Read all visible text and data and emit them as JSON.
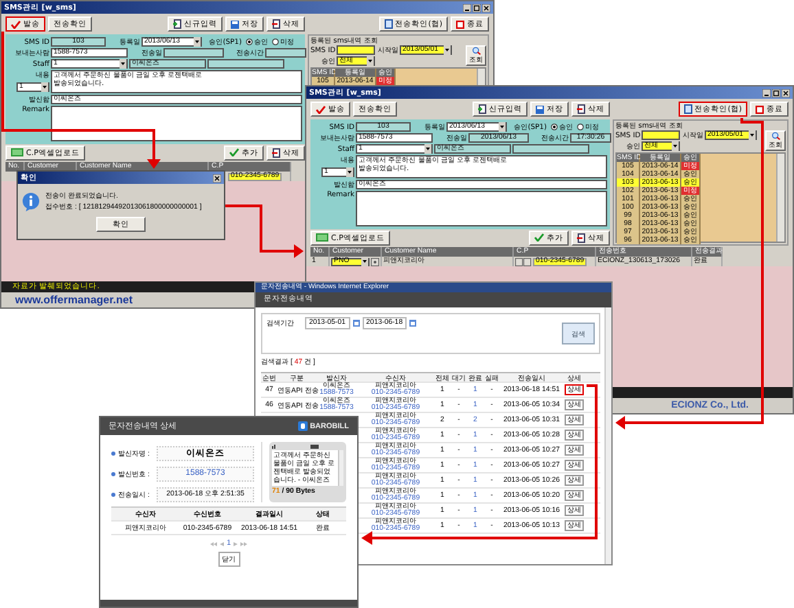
{
  "sms_windows": [
    {
      "title": "SMS관리 [w_sms]",
      "actions_left": [
        {
          "label": "발송",
          "kind": "check",
          "highlighted": true
        },
        {
          "label": "전송확인",
          "kind": "plain",
          "highlighted": false
        }
      ],
      "actions_mid": [
        {
          "label": "신규입력",
          "kind": "new",
          "highlighted": false
        },
        {
          "label": "저장",
          "kind": "save",
          "highlighted": false
        },
        {
          "label": "삭제",
          "kind": "delete",
          "highlighted": false
        }
      ],
      "actions_right": [
        {
          "label": "전송확인(협)",
          "kind": "doc",
          "highlighted": false
        },
        {
          "label": "종료",
          "kind": "exit",
          "highlighted": false
        }
      ],
      "form": {
        "sms_id_label": "SMS ID",
        "sms_id": "103",
        "reg_label": "등록일",
        "reg_date": "2013/06/13",
        "approval_label": "승인(SP1)",
        "approval": [
          {
            "label": "승인",
            "selected": true
          },
          {
            "label": "미정",
            "selected": false
          }
        ],
        "sender_label": "보내는사람",
        "sender": "1588-7573",
        "sent_date_label": "전송일",
        "sent_time_label": "전송시간",
        "staff_label": "Staff",
        "staff": "1",
        "staff_name": "이씨온즈",
        "content_label": "내용",
        "content": "고객께서 주문하신 물품이 금일 오후 로젠택배로\n발송되었습니다.",
        "count": "1",
        "from_label": "발신함",
        "from": "이씨온즈",
        "remark_label": "Remark"
      },
      "lookup": {
        "title": "등록된 sms내역 조회",
        "sms_id_label": "SMS ID",
        "start_label": "시작일",
        "start_date": "2013/05/01",
        "approval_label": "승인",
        "approval": "전체",
        "search": "조회",
        "columns": [
          "SMS ID",
          "등록일",
          "승인"
        ],
        "rows": [
          {
            "id": "105",
            "date": "2013-06-14",
            "status": "미정",
            "pending": true,
            "selected": false
          }
        ]
      },
      "cp": {
        "upload": "C.P엑셀업로드",
        "add": "추가",
        "delete": "삭제",
        "columns": [
          "No.",
          "Customer",
          "Customer Name",
          "C.P"
        ],
        "rows": [
          {
            "cp": "010-2345-6789"
          }
        ]
      },
      "status": "자료가 발췌되었습니다.",
      "url": "www.offermanager.net"
    },
    {
      "title": "SMS관리 [w_sms]",
      "actions_left": [
        {
          "label": "발송",
          "kind": "check",
          "highlighted": false
        },
        {
          "label": "전송확인",
          "kind": "plain",
          "highlighted": false
        }
      ],
      "actions_mid": [
        {
          "label": "신규입력",
          "kind": "new",
          "highlighted": false
        },
        {
          "label": "저장",
          "kind": "save",
          "highlighted": false
        },
        {
          "label": "삭제",
          "kind": "delete",
          "highlighted": false
        }
      ],
      "actions_right": [
        {
          "label": "전송확인(협)",
          "kind": "doc",
          "highlighted": true
        },
        {
          "label": "종료",
          "kind": "exit",
          "highlighted": false
        }
      ],
      "form": {
        "sms_id_label": "SMS ID",
        "sms_id": "103",
        "reg_label": "등록일",
        "reg_date": "2013/06/13",
        "approval_label": "승인(SP1)",
        "approval": [
          {
            "label": "승인",
            "selected": true
          },
          {
            "label": "미정",
            "selected": false
          }
        ],
        "sender_label": "보내는사람",
        "sender": "1588-7573",
        "sent_date_label": "전송일",
        "sent_date": "2013/06/13",
        "sent_time_label": "전송시간",
        "sent_time": "17:30:26",
        "staff_label": "Staff",
        "staff": "1",
        "staff_name": "이씨온즈",
        "content_label": "내용",
        "content": "고객께서 주문하신 물품이 금일 오후 로젠택배로\n발송되었습니다.",
        "count": "1",
        "from_label": "발신함",
        "from": "이씨온즈",
        "remark_label": "Remark"
      },
      "lookup": {
        "title": "등록된 sms내역 조회",
        "sms_id_label": "SMS ID",
        "start_label": "시작일",
        "start_date": "2013/05/01",
        "approval_label": "승인",
        "approval": "전체",
        "search": "조회",
        "columns": [
          "SMS ID",
          "등록일",
          "승인"
        ],
        "rows": [
          {
            "id": "105",
            "date": "2013-06-14",
            "status": "미정",
            "pending": true,
            "selected": false
          },
          {
            "id": "104",
            "date": "2013-06-14",
            "status": "승인",
            "pending": false,
            "selected": false
          },
          {
            "id": "103",
            "date": "2013-06-13",
            "status": "승인",
            "pending": false,
            "selected": true
          },
          {
            "id": "102",
            "date": "2013-06-13",
            "status": "미정",
            "pending": true,
            "selected": false
          },
          {
            "id": "101",
            "date": "2013-06-13",
            "status": "승인",
            "pending": false,
            "selected": false
          },
          {
            "id": "100",
            "date": "2013-06-13",
            "status": "승인",
            "pending": false,
            "selected": false
          },
          {
            "id": "99",
            "date": "2013-06-13",
            "status": "승인",
            "pending": false,
            "selected": false
          },
          {
            "id": "98",
            "date": "2013-06-13",
            "status": "승인",
            "pending": false,
            "selected": false
          },
          {
            "id": "97",
            "date": "2013-06-13",
            "status": "승인",
            "pending": false,
            "selected": false
          },
          {
            "id": "96",
            "date": "2013-06-13",
            "status": "승인",
            "pending": false,
            "selected": false
          }
        ]
      },
      "cp": {
        "upload": "C.P엑셀업로드",
        "add": "추가",
        "delete": "삭제",
        "columns": [
          "No.",
          "Customer",
          "Customer Name",
          "C.P",
          "전송번호",
          "전송결과"
        ],
        "rows": [
          {
            "no": "1",
            "customer": "PNO",
            "name": "피앤지코리아",
            "cp": "010-2345-6789",
            "send_no": "ECIONZ_130613_173026",
            "result": "완료"
          }
        ]
      },
      "company": "ECIONZ Co., Ltd."
    }
  ],
  "dialog": {
    "title": "확인",
    "lines": [
      "전송이 완료되었습니다.",
      "접수번호 : [ 12181294492013061800000000001 ]"
    ],
    "button": "확인"
  },
  "browser": {
    "title": "문자전송내역 - Windows Internet Explorer",
    "header": "문자전송내역",
    "period_label": "검색기간",
    "from": "2013-05-01",
    "to": "2013-06-18",
    "search": "검색",
    "result_label": "검색결과 [",
    "result_count": "47",
    "result_unit": "건 ]",
    "columns": [
      "순번",
      "구분",
      "발신자",
      "수신자",
      "전체",
      "대기",
      "완료",
      "실패",
      "전송일시",
      "상세"
    ],
    "rows": [
      {
        "no": "47",
        "type": "연동API 전송",
        "sender": "이씨온즈",
        "sender_no": "1588-7573",
        "receiver": "피앤지코리아",
        "receiver_no": "010-2345-6789",
        "total": "1",
        "waiting": "-",
        "done": "1",
        "failed": "-",
        "date": "2013-06-18 14:51",
        "detail": "상세",
        "highlighted": true
      },
      {
        "no": "46",
        "type": "연동API 전송",
        "sender": "이씨온즈",
        "sender_no": "1588-7573",
        "receiver": "피앤지코리아",
        "receiver_no": "010-2345-6789",
        "total": "1",
        "waiting": "-",
        "done": "1",
        "failed": "-",
        "date": "2013-06-05 10:34",
        "detail": "상세",
        "highlighted": false
      },
      {
        "receiver": "피앤지코리아",
        "receiver_no": "010-2345-6789",
        "total": "2",
        "waiting": "-",
        "done": "2",
        "failed": "-",
        "date": "2013-06-05 10:31",
        "detail": "상세",
        "highlighted": false
      },
      {
        "receiver": "피앤지코리아",
        "receiver_no": "010-2345-6789",
        "total": "1",
        "waiting": "-",
        "done": "1",
        "failed": "-",
        "date": "2013-06-05 10:28",
        "detail": "상세",
        "highlighted": false
      },
      {
        "receiver": "피앤지코리아",
        "receiver_no": "010-2345-6789",
        "total": "1",
        "waiting": "-",
        "done": "1",
        "failed": "-",
        "date": "2013-06-05 10:27",
        "detail": "상세",
        "highlighted": false
      },
      {
        "receiver": "피앤지코리아",
        "receiver_no": "010-2345-6789",
        "total": "1",
        "waiting": "-",
        "done": "1",
        "failed": "-",
        "date": "2013-06-05 10:27",
        "detail": "상세",
        "highlighted": false
      },
      {
        "receiver": "피앤지코리아",
        "receiver_no": "010-2345-6789",
        "total": "1",
        "waiting": "-",
        "done": "1",
        "failed": "-",
        "date": "2013-06-05 10:26",
        "detail": "상세",
        "highlighted": false
      },
      {
        "receiver": "피앤지코리아",
        "receiver_no": "010-2345-6789",
        "total": "1",
        "waiting": "-",
        "done": "1",
        "failed": "-",
        "date": "2013-06-05 10:20",
        "detail": "상세",
        "highlighted": false
      },
      {
        "receiver": "피앤지코리아",
        "receiver_no": "010-2345-6789",
        "total": "1",
        "waiting": "-",
        "done": "1",
        "failed": "-",
        "date": "2013-06-05 10:16",
        "detail": "상세",
        "highlighted": false
      },
      {
        "receiver": "피앤지코리아",
        "receiver_no": "010-2345-6789",
        "total": "1",
        "waiting": "-",
        "done": "1",
        "failed": "-",
        "date": "2013-06-05 10:13",
        "detail": "상세",
        "highlighted": false
      }
    ]
  },
  "detail": {
    "title": "문자전송내역 상세",
    "brand": "BAROBILL",
    "fields": [
      {
        "label": "발신자명 :",
        "value": "이씨온즈",
        "kind": "name"
      },
      {
        "label": "발신번호 :",
        "value": "1588-7573",
        "kind": "phone"
      },
      {
        "label": "전송일시 :",
        "value": "2013-06-18 오후 2:51:35",
        "kind": "date"
      }
    ],
    "message": "고객께서 주문하신 물품이 금일 오후 로젠택배로 발송되었습니다. - 이씨온즈",
    "bytes_used": "71",
    "bytes_total": "/ 90 Bytes",
    "columns": [
      "수신자",
      "수신번호",
      "결과일시",
      "상태"
    ],
    "rows": [
      [
        "피앤지코리아",
        "010-2345-6789",
        "2013-06-18 14:51",
        "완료"
      ]
    ],
    "page": "1",
    "close": "닫기"
  }
}
